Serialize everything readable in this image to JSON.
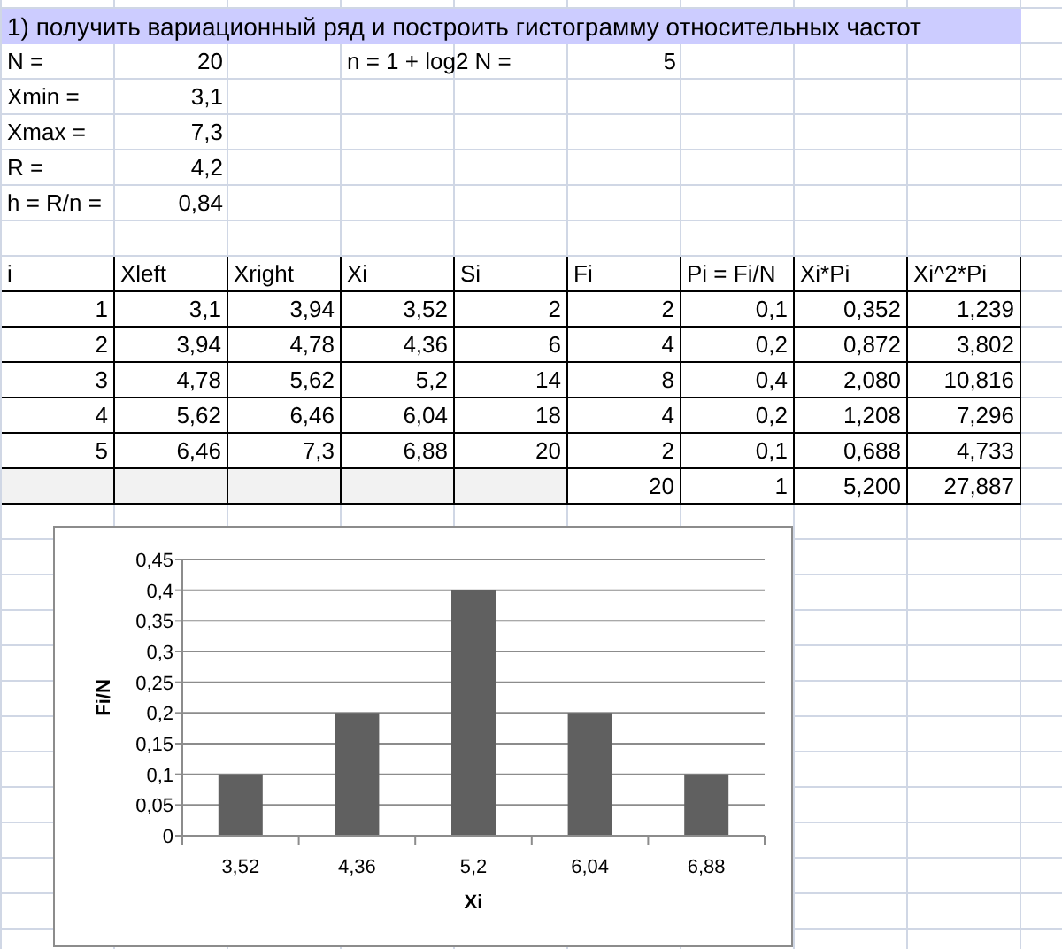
{
  "title": "1) получить вариационный ряд и построить гистограмму относительных частот",
  "params": [
    {
      "label": "N =",
      "value": "20"
    },
    {
      "label": "Xmin =",
      "value": "3,1"
    },
    {
      "label": "Xmax =",
      "value": "7,3"
    },
    {
      "label": "R =",
      "value": "4,2"
    },
    {
      "label": "h = R/n =",
      "value": "0,84"
    }
  ],
  "formula": {
    "label": "n = 1 + log2 N =",
    "value": "5"
  },
  "table": {
    "columns": [
      "i",
      "Xleft",
      "Xright",
      "Xi",
      "Si",
      "Fi",
      "Pi = Fi/N",
      "Xi*Pi",
      "Xi^2*Pi"
    ],
    "rows": [
      [
        "1",
        "3,1",
        "3,94",
        "3,52",
        "2",
        "2",
        "0,1",
        "0,352",
        "1,239"
      ],
      [
        "2",
        "3,94",
        "4,78",
        "4,36",
        "6",
        "4",
        "0,2",
        "0,872",
        "3,802"
      ],
      [
        "3",
        "4,78",
        "5,62",
        "5,2",
        "14",
        "8",
        "0,4",
        "2,080",
        "10,816"
      ],
      [
        "4",
        "5,62",
        "6,46",
        "6,04",
        "18",
        "4",
        "0,2",
        "1,208",
        "7,296"
      ],
      [
        "5",
        "6,46",
        "7,3",
        "6,88",
        "20",
        "2",
        "0,1",
        "0,688",
        "4,733"
      ]
    ],
    "totals": [
      "20",
      "1",
      "5,200",
      "27,887"
    ]
  },
  "chart": {
    "chart_data": {
      "type": "bar",
      "xlabel": "Xi",
      "ylabel": "Fi/N",
      "categories": [
        "3,52",
        "4,36",
        "5,2",
        "6,04",
        "6,88"
      ],
      "values": [
        0.1,
        0.2,
        0.4,
        0.2,
        0.1
      ],
      "ylim": [
        0,
        0.45
      ],
      "grid": true,
      "yticks": [
        {
          "value": 0,
          "label": "0"
        },
        {
          "value": 0.05,
          "label": "0,05"
        },
        {
          "value": 0.1,
          "label": "0,1"
        },
        {
          "value": 0.15,
          "label": "0,15"
        },
        {
          "value": 0.2,
          "label": "0,2"
        },
        {
          "value": 0.25,
          "label": "0,25"
        },
        {
          "value": 0.3,
          "label": "0,3"
        },
        {
          "value": 0.35,
          "label": "0,35"
        },
        {
          "value": 0.4,
          "label": "0,4"
        },
        {
          "value": 0.45,
          "label": "0,45"
        }
      ]
    }
  }
}
